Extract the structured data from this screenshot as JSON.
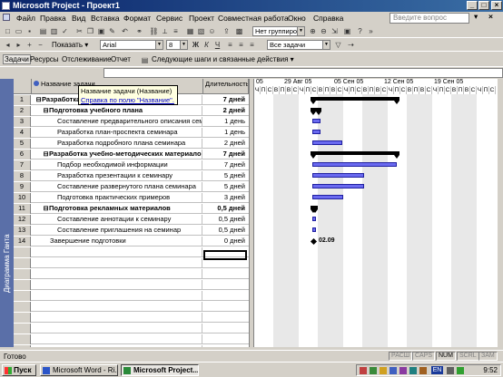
{
  "window": {
    "title": "Microsoft Project - Проект1"
  },
  "menu": {
    "items": [
      "Файл",
      "Правка",
      "Вид",
      "Вставка",
      "Формат",
      "Сервис",
      "Проект",
      "Совместная работа",
      "Окно",
      "Справка"
    ],
    "help_placeholder": "Введите вопрос"
  },
  "toolbar1": {
    "grouping": "Нет группировки",
    "filter": "Все задачи"
  },
  "toolbar2": {
    "show_label": "Показать",
    "font": "Arial",
    "size": "8"
  },
  "guide_bar": {
    "tasks": "Задачи",
    "resources": "Ресурсы",
    "tracking": "Отслеживание",
    "report": "Отчет",
    "next_steps": "Следующие шаги и связанные действия"
  },
  "sidebar": {
    "label": "Диаграмма Ганта"
  },
  "table": {
    "col_name": "Название задачи",
    "col_duration": "Длительность",
    "rows": [
      {
        "id": "1",
        "name": "Разработка",
        "duration": "7 дней",
        "level": 0,
        "summary": true
      },
      {
        "id": "2",
        "name": "Подготовка учебного плана",
        "duration": "2 дней",
        "level": 1,
        "summary": true
      },
      {
        "id": "3",
        "name": "Составление предварительного описания семи",
        "duration": "1 день",
        "level": 2,
        "summary": false
      },
      {
        "id": "4",
        "name": "Разработка план-проспекта семинара",
        "duration": "1 день",
        "level": 2,
        "summary": false
      },
      {
        "id": "5",
        "name": "Разработка подробного плана семинара",
        "duration": "2 дней",
        "level": 2,
        "summary": false
      },
      {
        "id": "6",
        "name": "Разработка учебно-методических материало",
        "duration": "7 дней",
        "level": 1,
        "summary": true
      },
      {
        "id": "7",
        "name": "Подбор необходимой информации",
        "duration": "7 дней",
        "level": 2,
        "summary": false
      },
      {
        "id": "8",
        "name": "Разработка презентации к семинару",
        "duration": "5 дней",
        "level": 2,
        "summary": false
      },
      {
        "id": "9",
        "name": "Составление  развернутого плана семинара",
        "duration": "5 дней",
        "level": 2,
        "summary": false
      },
      {
        "id": "10",
        "name": "Подготовка практических примеров",
        "duration": "3 дней",
        "level": 2,
        "summary": false
      },
      {
        "id": "11",
        "name": "Подготовка рекламных материалов",
        "duration": "0,5 дней",
        "level": 1,
        "summary": true
      },
      {
        "id": "12",
        "name": "Составление аннотации к семинару",
        "duration": "0,5 дней",
        "level": 2,
        "summary": false
      },
      {
        "id": "13",
        "name": "Составление приглашения на семинар",
        "duration": "0,5 дней",
        "level": 2,
        "summary": false
      },
      {
        "id": "14",
        "name": "Завершение подготовки",
        "duration": "0 дней",
        "level": 1,
        "summary": false
      }
    ]
  },
  "tooltip": {
    "line1": "Название задачи (Название)",
    "line2": "Справка по полю \"Название\"."
  },
  "gantt": {
    "weeks": [
      "05",
      "29 Авг 05",
      "05 Сен 05",
      "12 Сен 05",
      "19 Сен 05"
    ],
    "days": [
      "Ч",
      "П",
      "С",
      "В",
      "П",
      "В",
      "С",
      "Ч",
      "П",
      "С",
      "В",
      "П",
      "В",
      "С",
      "Ч",
      "П",
      "С",
      "В",
      "П",
      "В",
      "С",
      "Ч",
      "П",
      "С",
      "В",
      "П",
      "В",
      "С",
      "Ч",
      "П",
      "С",
      "В",
      "П",
      "В",
      "С",
      "Ч",
      "П",
      "С"
    ],
    "milestone_label": "02.09"
  },
  "status": {
    "ready": "Готово",
    "indicators": [
      "РАСШ",
      "CAPS",
      "NUM",
      "SCRL",
      "ЗАМ"
    ]
  },
  "taskbar": {
    "start": "Пуск",
    "tasks": [
      "Microsoft Word - Ri...",
      "Microsoft Project..."
    ],
    "lang": "EN",
    "time": "9:52"
  }
}
